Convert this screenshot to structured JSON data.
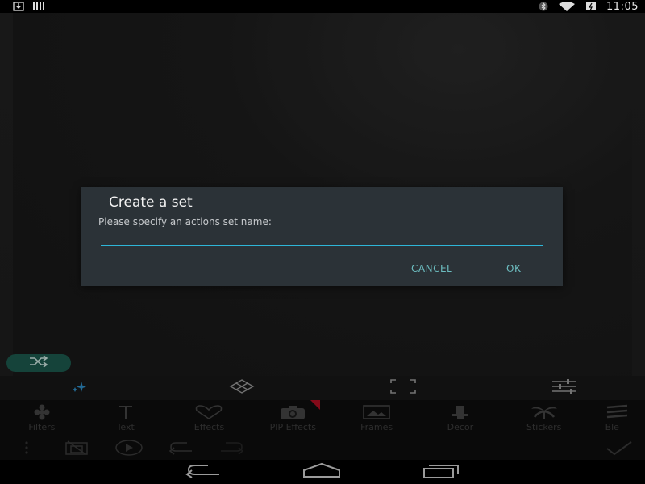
{
  "status_bar": {
    "time": "11:05",
    "icons": [
      "download-icon",
      "signal-bars-icon",
      "bluetooth-icon",
      "wifi-icon",
      "battery-icon"
    ]
  },
  "tool_tabs": [
    {
      "icon": "sparkle-icon",
      "active": true
    },
    {
      "icon": "clipboard-icon",
      "active": false
    },
    {
      "icon": "crop-frame-icon",
      "active": false
    },
    {
      "icon": "sliders-icon",
      "active": false
    }
  ],
  "tools": [
    {
      "label": "Filters",
      "icon": "flower-icon"
    },
    {
      "label": "Text",
      "icon": "text-t-icon"
    },
    {
      "label": "Effects",
      "icon": "heart-icon"
    },
    {
      "label": "PIP Effects",
      "icon": "camera-icon"
    },
    {
      "label": "Frames",
      "icon": "frame-icon"
    },
    {
      "label": "Decor",
      "icon": "hat-icon"
    },
    {
      "label": "Stickers",
      "icon": "palm-tree-icon"
    },
    {
      "label": "Ble",
      "icon": "blend-icon"
    }
  ],
  "dialog": {
    "title": "Create a set",
    "message": "Please specify an actions set name:",
    "input_value": "",
    "cancel_label": "CANCEL",
    "ok_label": "OK"
  },
  "colors": {
    "accent_teal": "#1c5a4e",
    "dialog_bg": "#2b3237",
    "input_underline": "#2eb6d8",
    "button_text": "#6cbcbf",
    "ribbon_red": "#b00e22"
  }
}
